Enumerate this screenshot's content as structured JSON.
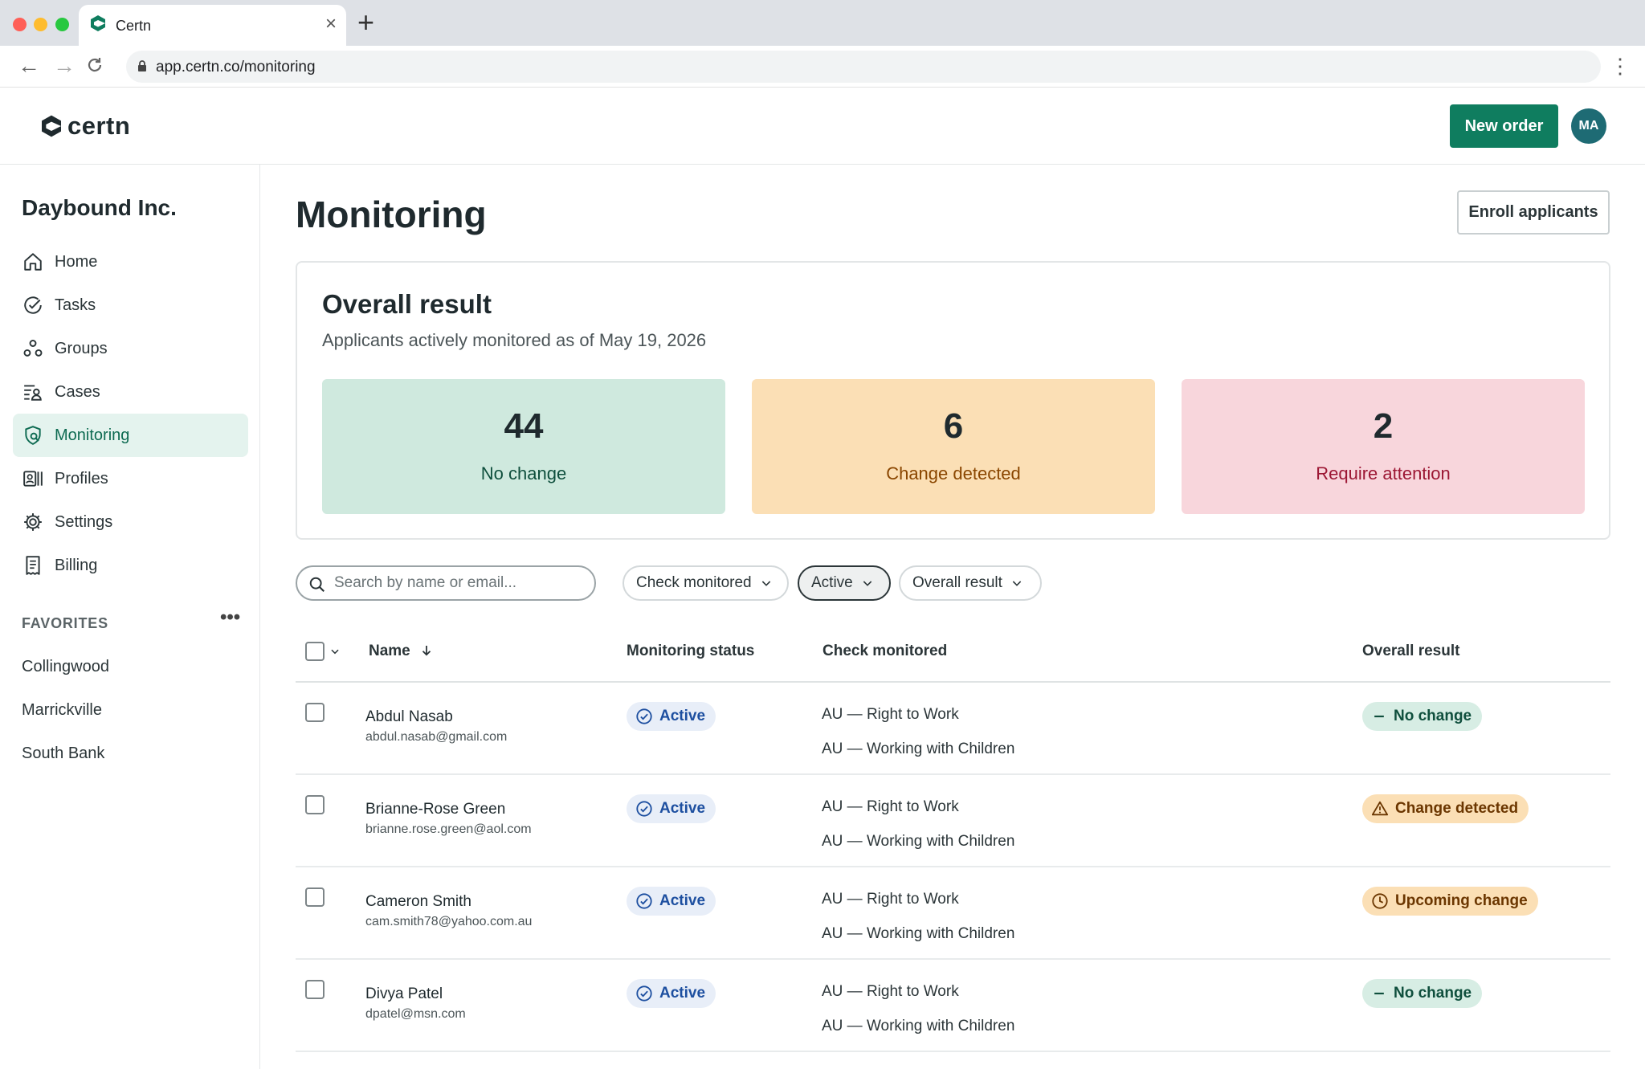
{
  "browser": {
    "tab_title": "Certn",
    "url": "app.certn.co/monitoring",
    "new_tab_icon": "plus-icon"
  },
  "header": {
    "logo_text": "certn",
    "new_order_label": "New order",
    "avatar_initials": "MA",
    "accent_color": "#0f7d5f"
  },
  "sidebar": {
    "org_name": "Daybound Inc.",
    "items": [
      {
        "label": "Home",
        "icon": "home-icon"
      },
      {
        "label": "Tasks",
        "icon": "check-circle-icon"
      },
      {
        "label": "Groups",
        "icon": "groups-icon"
      },
      {
        "label": "Cases",
        "icon": "cases-icon"
      },
      {
        "label": "Monitoring",
        "icon": "monitoring-icon",
        "active": true
      },
      {
        "label": "Profiles",
        "icon": "profiles-icon"
      },
      {
        "label": "Settings",
        "icon": "gear-icon"
      },
      {
        "label": "Billing",
        "icon": "receipt-icon"
      }
    ],
    "favorites_header": "FAVORITES",
    "favorites": [
      "Collingwood",
      "Marrickville",
      "South Bank"
    ]
  },
  "main": {
    "title": "Monitoring",
    "enroll_label": "Enroll applicants",
    "overall": {
      "title": "Overall result",
      "subtitle": "Applicants actively monitored as of May 19, 2026",
      "stats": [
        {
          "value": "44",
          "label": "No change",
          "bg": "#cfe9de",
          "color": "#0f4f3d"
        },
        {
          "value": "6",
          "label": "Change detected",
          "bg": "#fbdfb5",
          "color": "#8a4600"
        },
        {
          "value": "2",
          "label": "Require attention",
          "bg": "#f8d6dc",
          "color": "#9c1734"
        }
      ]
    },
    "filters": {
      "search_placeholder": "Search by name or email...",
      "check_monitored": "Check monitored",
      "active": "Active",
      "overall_result": "Overall result"
    },
    "table": {
      "headers": {
        "name": "Name",
        "status": "Monitoring status",
        "check": "Check monitored",
        "result": "Overall result"
      },
      "rows": [
        {
          "name": "Abdul Nasab",
          "email": "abdul.nasab@gmail.com",
          "status": "Active",
          "check1": "AU — Right to Work",
          "check2": "AU — Working with Children",
          "result": "No change",
          "result_type": "nochange"
        },
        {
          "name": "Brianne-Rose Green",
          "email": "brianne.rose.green@aol.com",
          "status": "Active",
          "check1": "AU — Right to Work",
          "check2": "AU — Working with Children",
          "result": "Change detected",
          "result_type": "change"
        },
        {
          "name": "Cameron Smith",
          "email": "cam.smith78@yahoo.com.au",
          "status": "Active",
          "check1": "AU — Right to Work",
          "check2": "AU — Working with Children",
          "result": "Upcoming change",
          "result_type": "upcoming"
        },
        {
          "name": "Divya Patel",
          "email": "dpatel@msn.com",
          "status": "Active",
          "check1": "AU — Right to Work",
          "check2": "AU — Working with Children",
          "result": "No change",
          "result_type": "nochange"
        }
      ]
    }
  }
}
